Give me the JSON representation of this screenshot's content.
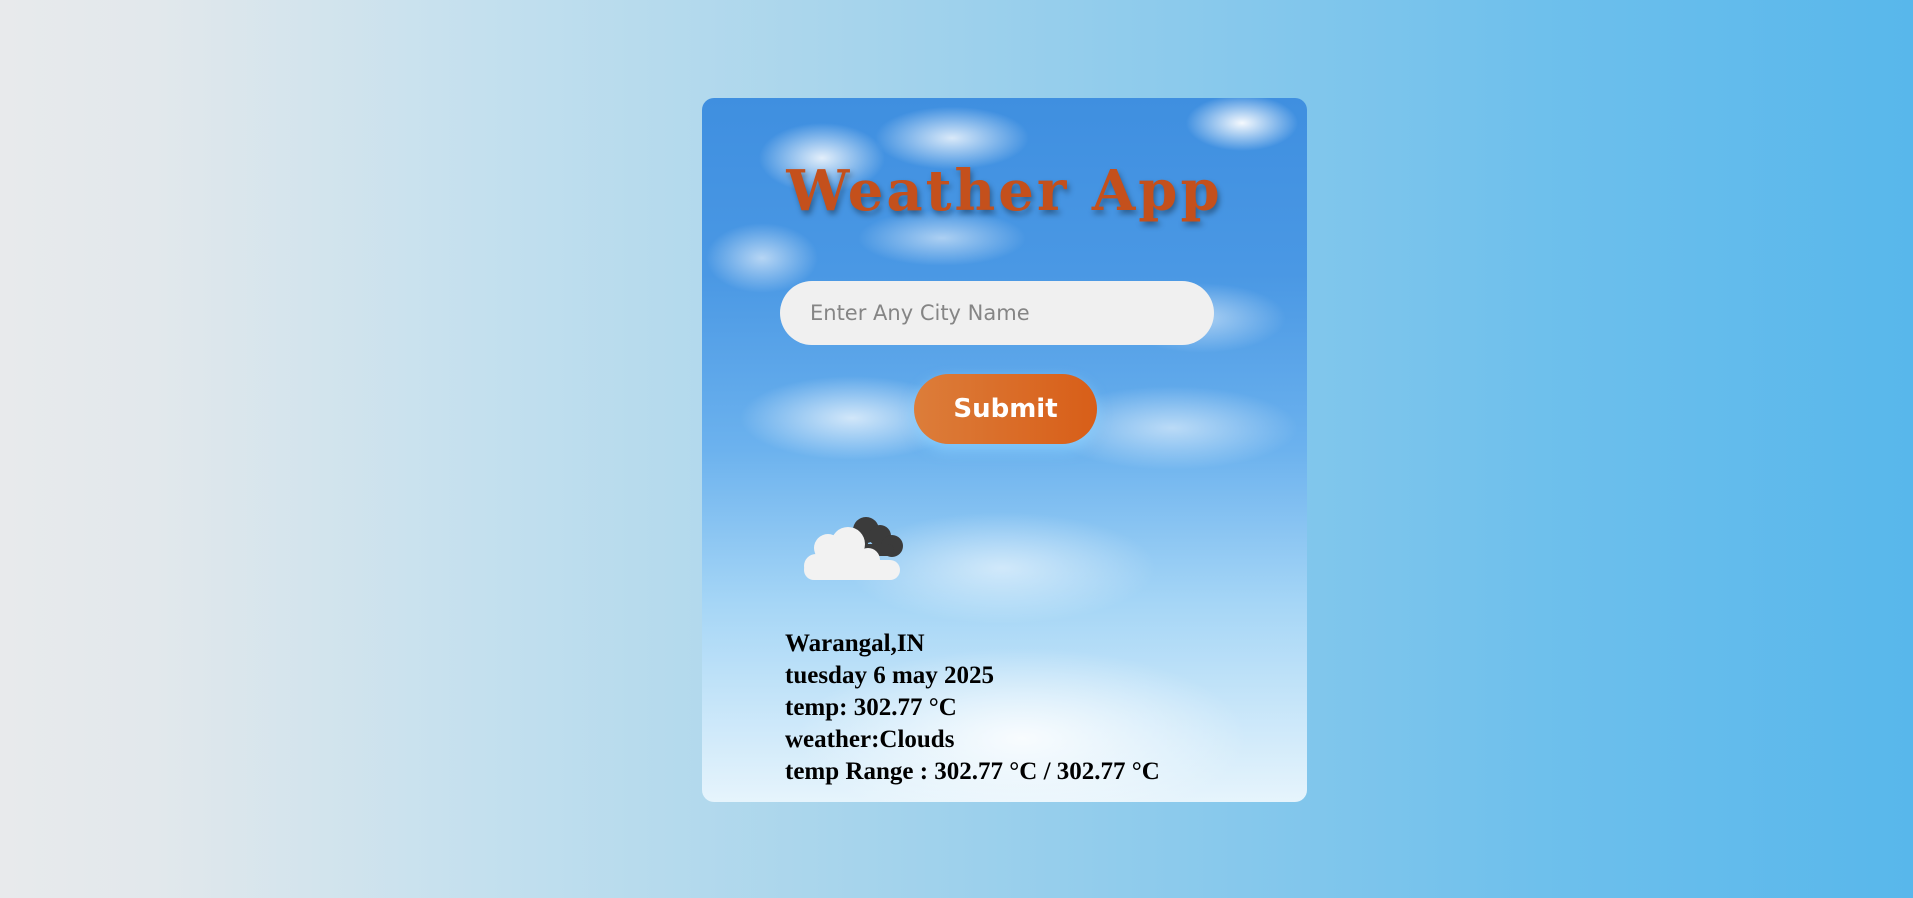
{
  "app": {
    "title": "Weather App"
  },
  "search": {
    "placeholder": "Enter Any City Name",
    "value": ""
  },
  "submit_label": "Submit",
  "weather_icon": "clouds-icon",
  "result": {
    "location": "Warangal,IN",
    "date": "tuesday 6 may 2025",
    "temp": "temp: 302.77 °C",
    "weather": "weather:Clouds",
    "temp_range": "temp Range : 302.77 °C / 302.77 °C"
  },
  "colors": {
    "title": "#c4501c",
    "button": "#d96a26",
    "input_bg": "#f0f0f0"
  }
}
